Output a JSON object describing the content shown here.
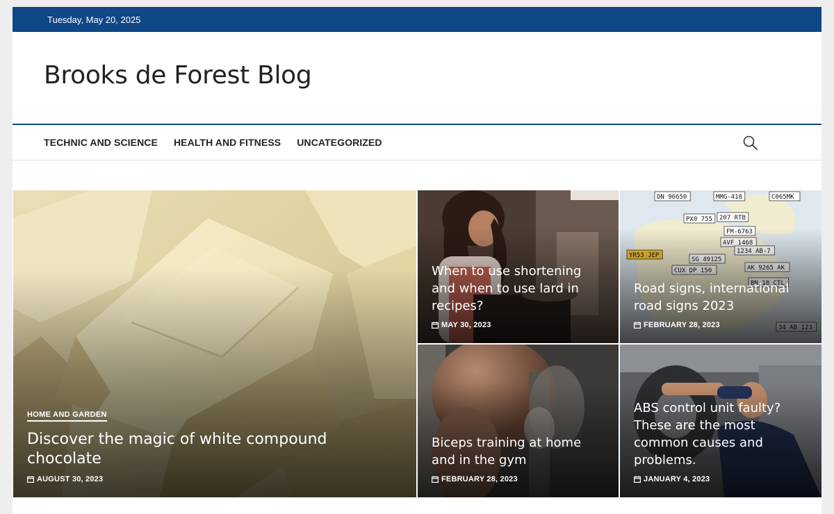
{
  "topbar": {
    "date": "Tuesday, May 20, 2025"
  },
  "header": {
    "site_title": "Brooks de Forest Blog"
  },
  "nav": {
    "items": [
      {
        "label": "TECHNIC AND SCIENCE"
      },
      {
        "label": "HEALTH AND FITNESS"
      },
      {
        "label": "UNCATEGORIZED"
      }
    ],
    "search_icon": "search-icon"
  },
  "featured": {
    "category": "HOME AND GARDEN",
    "title": "Discover the magic of white compound chocolate",
    "date": "AUGUST 30, 2023"
  },
  "posts": [
    {
      "title": "When to use shortening and when to use lard in recipes?",
      "date": "MAY 30, 2023"
    },
    {
      "title": "Road signs, international road signs 2023",
      "date": "FEBRUARY 28, 2023"
    },
    {
      "title": "Biceps training at home and in the gym",
      "date": "FEBRUARY 28, 2023"
    },
    {
      "title": "ABS control unit faulty? These are the most common causes and problems.",
      "date": "JANUARY 4, 2023"
    }
  ],
  "colors": {
    "brand_blue": "#0f4787",
    "text_dark": "#222222"
  },
  "icons": {
    "date_icon": "calendar-icon"
  },
  "map_plates": [
    "DN 96650",
    "MMG-418",
    "PX0 755",
    "207 RTB",
    "FM-6763",
    "AVF 1468",
    "YR53 JEP",
    "1234 AB-7",
    "SG 49125",
    "AK 9265 AK",
    "CUX DP 150",
    "BN 18 CTL",
    "C065MK",
    "34 AB 123"
  ]
}
